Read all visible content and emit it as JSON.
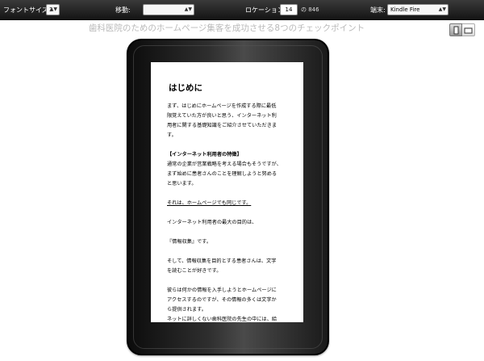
{
  "toolbar": {
    "font_size_label": "フォントサイズ:",
    "font_size_value": "3",
    "scroll_label": "移動:",
    "scroll_value": "",
    "location_label": "ロケーション:",
    "location_value": "14",
    "location_total": "の 846",
    "device_label": "端末:",
    "device_value": "Kindle Fire"
  },
  "page_title": "歯科医院のためのホームページ集客を成功させる8つのチェックポイント",
  "view_toggle": {
    "portrait_icon": "portrait-view-icon",
    "landscape_icon": "landscape-view-icon"
  },
  "book": {
    "heading": "はじめに",
    "lines": [
      "まず、はじめにホームページを作成する際に最低",
      "限覚えていた方が良いと思う、インターネット利",
      "用者に関する基礎知識をご紹介させていただきま",
      "す。",
      "",
      "【インターネット利用者の特徴】",
      "通常の企業が営業戦略を考える場合もそうですが、",
      "まず始めに患者さんのことを理解しようと努める",
      "と思います。",
      "",
      "それは、ホームページでも同じです。",
      "",
      "インターネット利用者の最大の目的は、",
      "",
      "『情報収集』です。",
      "",
      "そして、情報収集を目的とする患者さんは、文字",
      "を読むことが好きです。",
      "",
      "彼らは何かの情報を入手しようとホームページに",
      "アクセスするのですが、その情報の多くは文字か",
      "ら提供されます。",
      "ネットに詳しくない歯科医院の先生の中には、給"
    ]
  },
  "colors": {
    "toolbar_bg": "#1e1e1e",
    "title_text": "#b9b9b9",
    "device_body": "#1a1a1a"
  }
}
